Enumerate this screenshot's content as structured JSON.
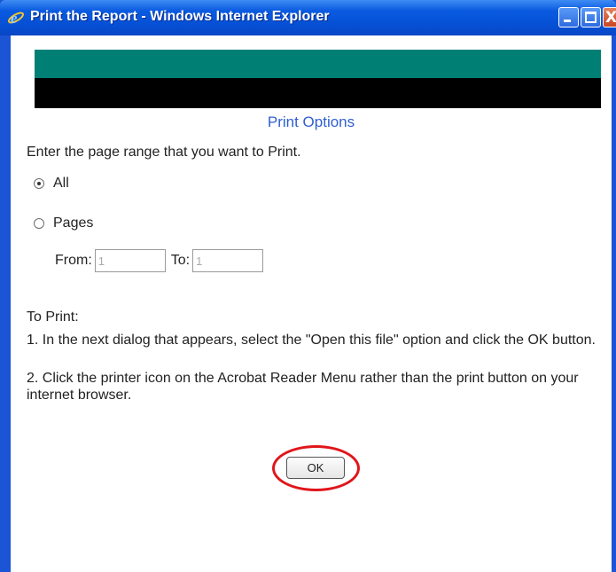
{
  "window": {
    "title": "Print the Report - Windows Internet Explorer",
    "close_glyph": "X"
  },
  "icons": {
    "app_icon": "internet-explorer-icon",
    "minimize": "minimize-icon",
    "maximize": "maximize-icon",
    "close": "close-icon"
  },
  "page": {
    "heading": "Print Options",
    "prompt": "Enter the page range that you want to Print.",
    "options": [
      {
        "label": "All",
        "selected": true
      },
      {
        "label": "Pages",
        "selected": false
      }
    ],
    "range": {
      "from_label": "From:",
      "from_value": "1",
      "to_label": "To:",
      "to_value": "1"
    },
    "instructions_title": "To Print:",
    "instructions": [
      "1. In the next dialog that appears, select the \"Open this file\" option and click the OK button.",
      "2. Click the printer icon on the Acrobat Reader Menu rather than the print button on your internet browser."
    ],
    "ok_label": "OK"
  },
  "colors": {
    "banner_teal": "#008075",
    "banner_black": "#000000",
    "heading": "#2f5fd0",
    "highlight": "#e0161b",
    "titlebar": "#0550d5"
  }
}
